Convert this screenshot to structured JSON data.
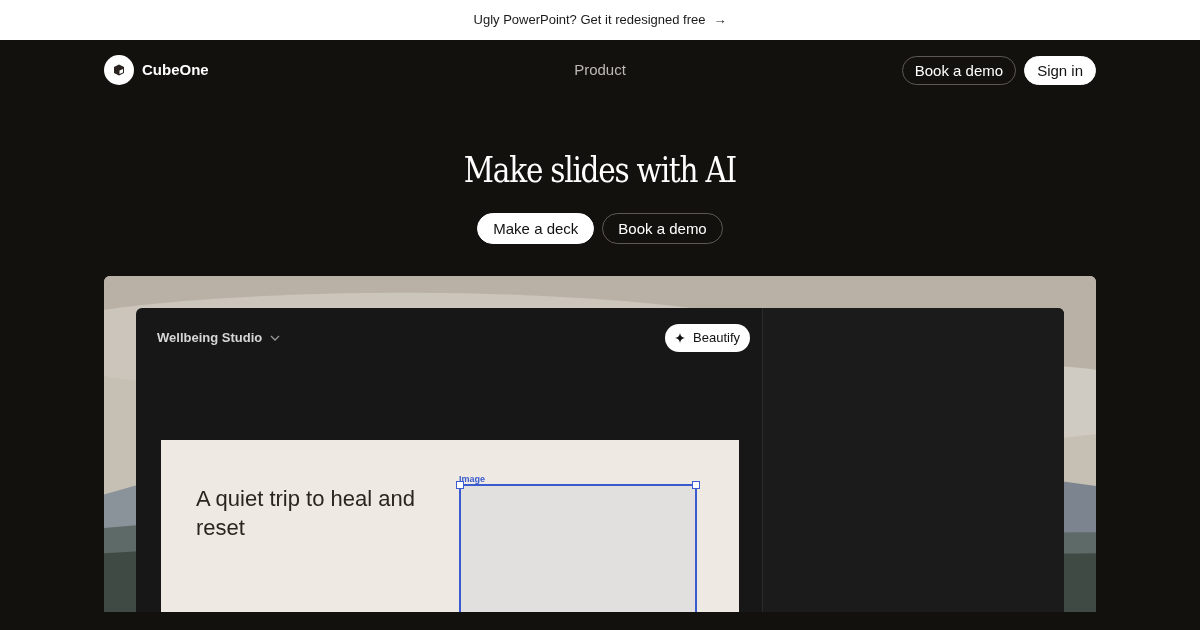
{
  "banner": {
    "text": "Ugly PowerPoint? Get it redesigned free",
    "arrow": "→"
  },
  "nav": {
    "brand": "CubeOne",
    "links": [
      "Product"
    ],
    "buttons": [
      {
        "label": "Book a demo",
        "kind": "outline"
      },
      {
        "label": "Sign in",
        "kind": "solid"
      }
    ]
  },
  "hero": {
    "title": "Make slides with AI",
    "buttons": [
      {
        "label": "Make a deck",
        "kind": "solid"
      },
      {
        "label": "Book a demo",
        "kind": "outline"
      }
    ]
  },
  "editor": {
    "deck_title": "Wellbeing Studio",
    "beautify_label": "Beautify",
    "slide": {
      "heading": "A quiet trip to heal and reset",
      "image_label": "Image"
    }
  }
}
